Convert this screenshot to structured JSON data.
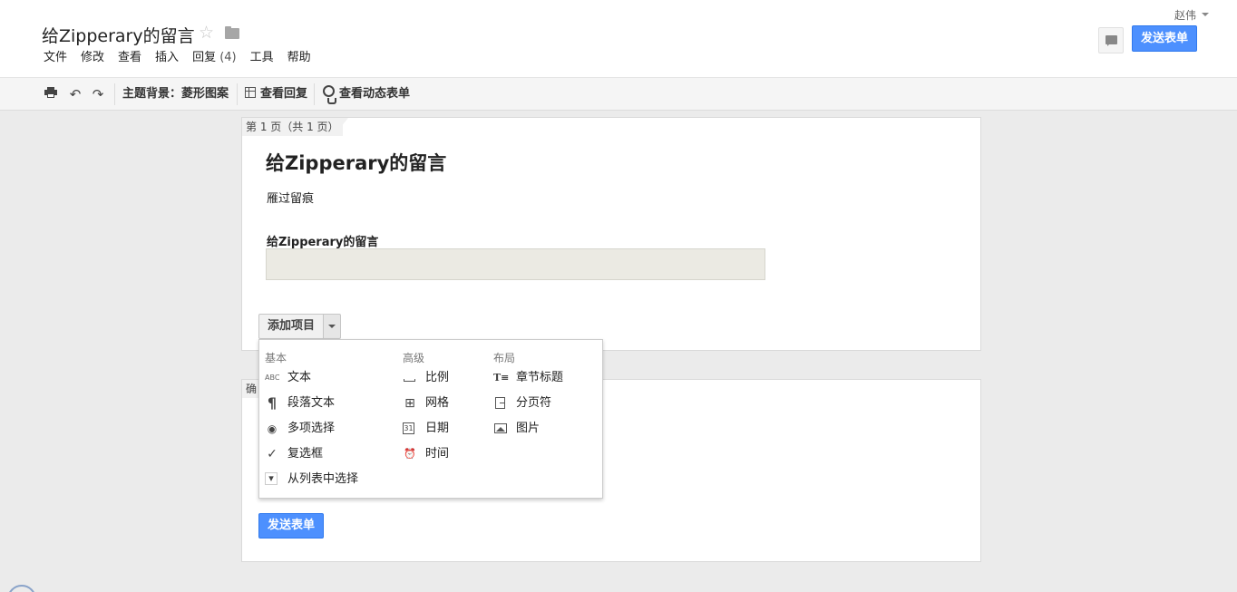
{
  "header": {
    "doc_title": "给Zipperary的留言",
    "menu": [
      "文件",
      "修改",
      "查看",
      "插入",
      "回复",
      "工具",
      "帮助"
    ],
    "reply_count": "(4)",
    "user_name": "赵伟",
    "send_button": "发送表单"
  },
  "toolbar": {
    "theme_label": "主题背景：菱形图案",
    "view_responses": "查看回复",
    "view_live_form": "查看动态表单"
  },
  "form": {
    "page_tab": "第 1 页（共 1 页）",
    "title": "给Zipperary的留言",
    "description": "雁过留痕",
    "question_title": "给Zipperary的留言",
    "add_item_label": "添加项目",
    "page2_tab": "确认",
    "send_button": "发送表单"
  },
  "dropdown": {
    "col_basic": "基本",
    "col_advanced": "高级",
    "col_layout": "布局",
    "basic": [
      {
        "label": "文本",
        "icon": "ABC"
      },
      {
        "label": "段落文本",
        "icon": "¶"
      },
      {
        "label": "多项选择",
        "icon": "◉"
      },
      {
        "label": "复选框",
        "icon": "✓"
      },
      {
        "label": "从列表中选择",
        "icon": "▾"
      }
    ],
    "advanced": [
      {
        "label": "比例",
        "icon": "scale-icon"
      },
      {
        "label": "网格",
        "icon": "grid-icon"
      },
      {
        "label": "日期",
        "icon": "31"
      },
      {
        "label": "时间",
        "icon": "⏰"
      }
    ],
    "layout": [
      {
        "label": "章节标题",
        "icon": "T≡"
      },
      {
        "label": "分页符",
        "icon": "page-break-icon"
      },
      {
        "label": "图片",
        "icon": "image-icon"
      }
    ]
  }
}
